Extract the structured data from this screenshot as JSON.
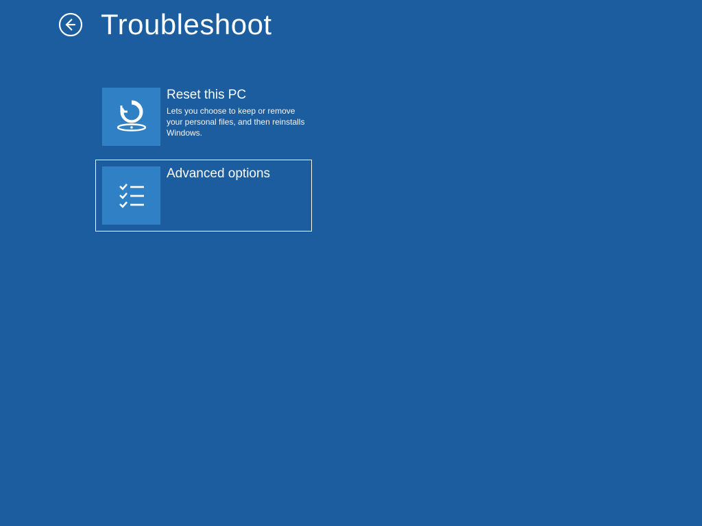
{
  "page": {
    "title": "Troubleshoot"
  },
  "options": [
    {
      "title": "Reset this PC",
      "description": "Lets you choose to keep or remove your personal files, and then reinstalls Windows."
    },
    {
      "title": "Advanced options",
      "description": ""
    }
  ]
}
